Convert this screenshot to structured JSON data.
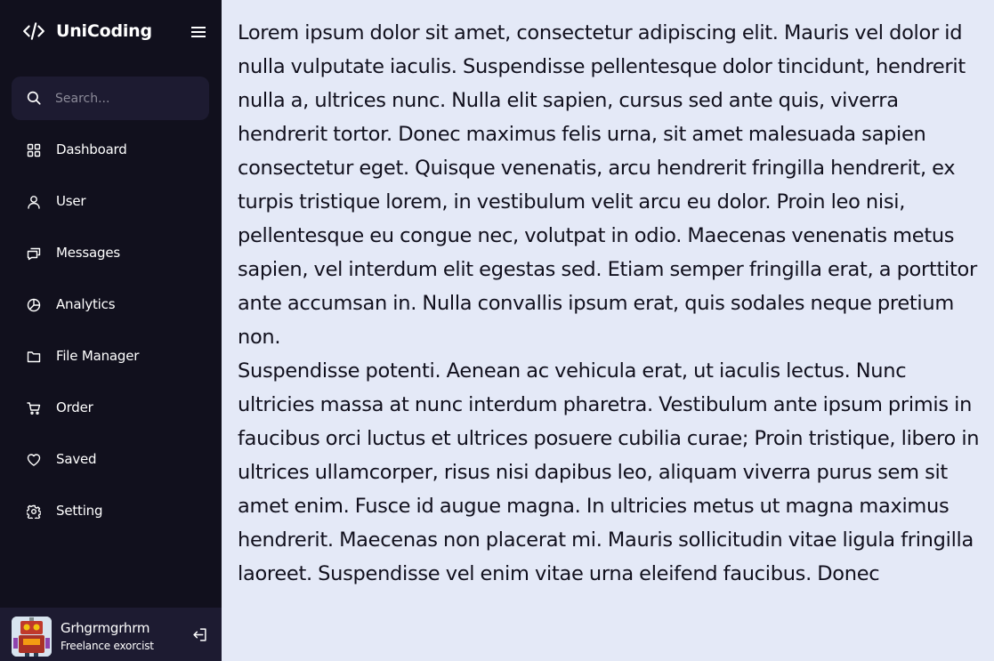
{
  "app": {
    "name": "UniCoding"
  },
  "search": {
    "placeholder": "Search..."
  },
  "nav": {
    "items": [
      {
        "label": "Dashboard",
        "icon": "grid-icon"
      },
      {
        "label": "User",
        "icon": "user-icon"
      },
      {
        "label": "Messages",
        "icon": "chat-icon"
      },
      {
        "label": "Analytics",
        "icon": "pie-chart-icon"
      },
      {
        "label": "File Manager",
        "icon": "folder-icon"
      },
      {
        "label": "Order",
        "icon": "cart-icon"
      },
      {
        "label": "Saved",
        "icon": "heart-icon"
      },
      {
        "label": "Setting",
        "icon": "gear-icon"
      }
    ]
  },
  "profile": {
    "name": "Grhgrmgrhrm",
    "job": "Freelance exorcist"
  },
  "main": {
    "paragraphs": [
      "Lorem ipsum dolor sit amet, consectetur adipiscing elit. Mauris vel dolor id nulla vulputate iaculis. Suspendisse pellentesque dolor tincidunt, hendrerit nulla a, ultrices nunc. Nulla elit sapien, cursus sed ante quis, viverra hendrerit tortor. Donec maximus felis urna, sit amet malesuada sapien consectetur eget. Quisque venenatis, arcu hendrerit fringilla hendrerit, ex turpis tristique lorem, in vestibulum velit arcu eu dolor. Proin leo nisi, pellentesque eu congue nec, volutpat in odio. Maecenas venenatis metus sapien, vel interdum elit egestas sed. Etiam semper fringilla erat, a porttitor ante accumsan in. Nulla convallis ipsum erat, quis sodales neque pretium non.",
      "Suspendisse potenti. Aenean ac vehicula erat, ut iaculis lectus. Nunc ultricies massa at nunc interdum pharetra. Vestibulum ante ipsum primis in faucibus orci luctus et ultrices posuere cubilia curae; Proin tristique, libero in ultrices ullamcorper, risus nisi dapibus leo, aliquam viverra purus sem sit amet enim. Fusce id augue magna. In ultricies metus ut magna maximus hendrerit. Maecenas non placerat mi. Mauris sollicitudin vitae ligula fringilla laoreet. Suspendisse vel enim vitae urna eleifend faucibus. Donec"
    ]
  },
  "colors": {
    "sidebar": "#11101d",
    "search_bg": "#1d1b31",
    "main_bg": "#e4e9f7",
    "text": "#11101d"
  }
}
